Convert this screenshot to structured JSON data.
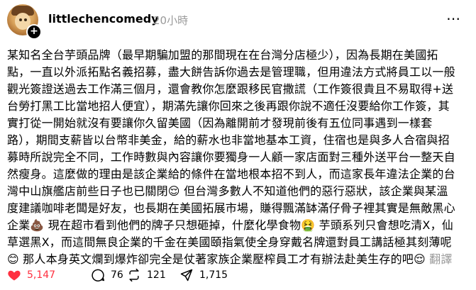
{
  "post": {
    "username": "littlechencomedy",
    "time": "20小時",
    "more_label": "⋯",
    "body_lines": [
      "某知名全台芋頭品牌（最早期騙加盟的那間現在在台灣分店極少），因為長期在美國拓",
      "點，一直以外派拓點名義招募，盡大餅告訴你過去是管理職，但用違法方式將員工以一般",
      "觀光簽證送過去工作滿三個月，還會教你怎麼跟移民官撒謊（工作簽很貴且不易取得+送",
      "台勞打黑工比當地招人便宜），期滿先讓你回來之後再跟你說不適任沒要給你工作簽，其",
      "實打從一開始就沒有要讓你久留美國（因為離開前才發現前後有五位同事遇到一樣套",
      "路），期間支薪皆以台幣非美金，給的薪水也非當地基本工資，住宿也是與多人合宿與招",
      "募時所說完全不同，工作時數與內容讓你要獨身一人顧一家店面對三種外送平台一整天自",
      "然瘦身。這麼做的理由是該企業給的條件在當地根本招不到人，而這家長年違法企業的台",
      "灣中山旗艦店前些日子也已關閉😌 但台灣多數人不知道他們的惡行惡狀，該企業與某溫",
      "度建議咖啡老闆是好友，也長期在美國拓展市場，賺得飄滿缽滿仔骨子裡其實是無敵黑心",
      "企業💩 現在超市看到他們的牌子只想砸掉，什麼化學食物🤮 芋頭系列只會想吃清X，仙",
      "草選黑X，而這間無良企業的千金在美國頤指氣使全身穿戴名牌還對員工講話極其刻薄呢",
      "😊 那人本身英文爛到爆炸卻完全是仗著家族企業壓榨員工才有辦法赴美生存的吧😌"
    ],
    "translate_label": "翻譯"
  },
  "actions": {
    "likes": "5,147",
    "comments": "76",
    "reposts": "121",
    "shares": "1,715"
  },
  "colors": {
    "like": "#ff3040",
    "muted": "#999999"
  }
}
